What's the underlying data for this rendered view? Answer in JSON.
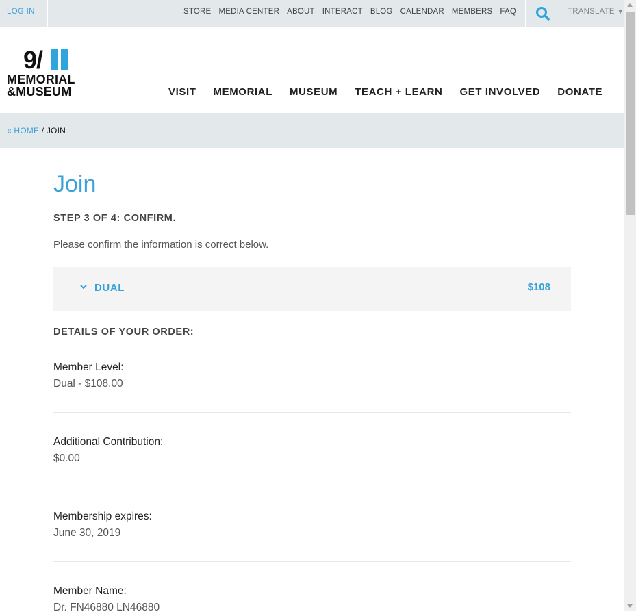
{
  "utility_bar": {
    "login": "LOG IN",
    "links": [
      "STORE",
      "MEDIA CENTER",
      "ABOUT",
      "INTERACT",
      "BLOG",
      "CALENDAR",
      "MEMBERS",
      "FAQ"
    ],
    "search_icon": "search-icon",
    "translate": "TRANSLATE",
    "translate_caret": "▼"
  },
  "logo": {
    "number": "9/",
    "line1": "MEMORIAL",
    "line2": "&MUSEUM",
    "accent_color": "#2ea6dd"
  },
  "main_nav": [
    "VISIT",
    "MEMORIAL",
    "MUSEUM",
    "TEACH + LEARN",
    "GET INVOLVED",
    "DONATE"
  ],
  "breadcrumb": {
    "home": "« HOME",
    "separator": "/",
    "current": "JOIN"
  },
  "page": {
    "title": "Join",
    "step": "STEP 3 OF 4: CONFIRM.",
    "instructions": "Please confirm the information is correct below."
  },
  "level": {
    "icon": "chevron-down-icon",
    "name": "DUAL",
    "price": "$108"
  },
  "details": {
    "heading": "DETAILS OF YOUR ORDER:",
    "items": [
      {
        "label": "Member Level:",
        "value": "Dual - $108.00"
      },
      {
        "label": "Additional Contribution:",
        "value": "$0.00"
      },
      {
        "label": "Membership expires:",
        "value": "June 30, 2019"
      },
      {
        "label": "Member Name:",
        "value": "Dr. FN46880 LN46880"
      }
    ]
  },
  "colors": {
    "accent": "#3aa2d6",
    "bar_bg": "#e3e8eb"
  }
}
